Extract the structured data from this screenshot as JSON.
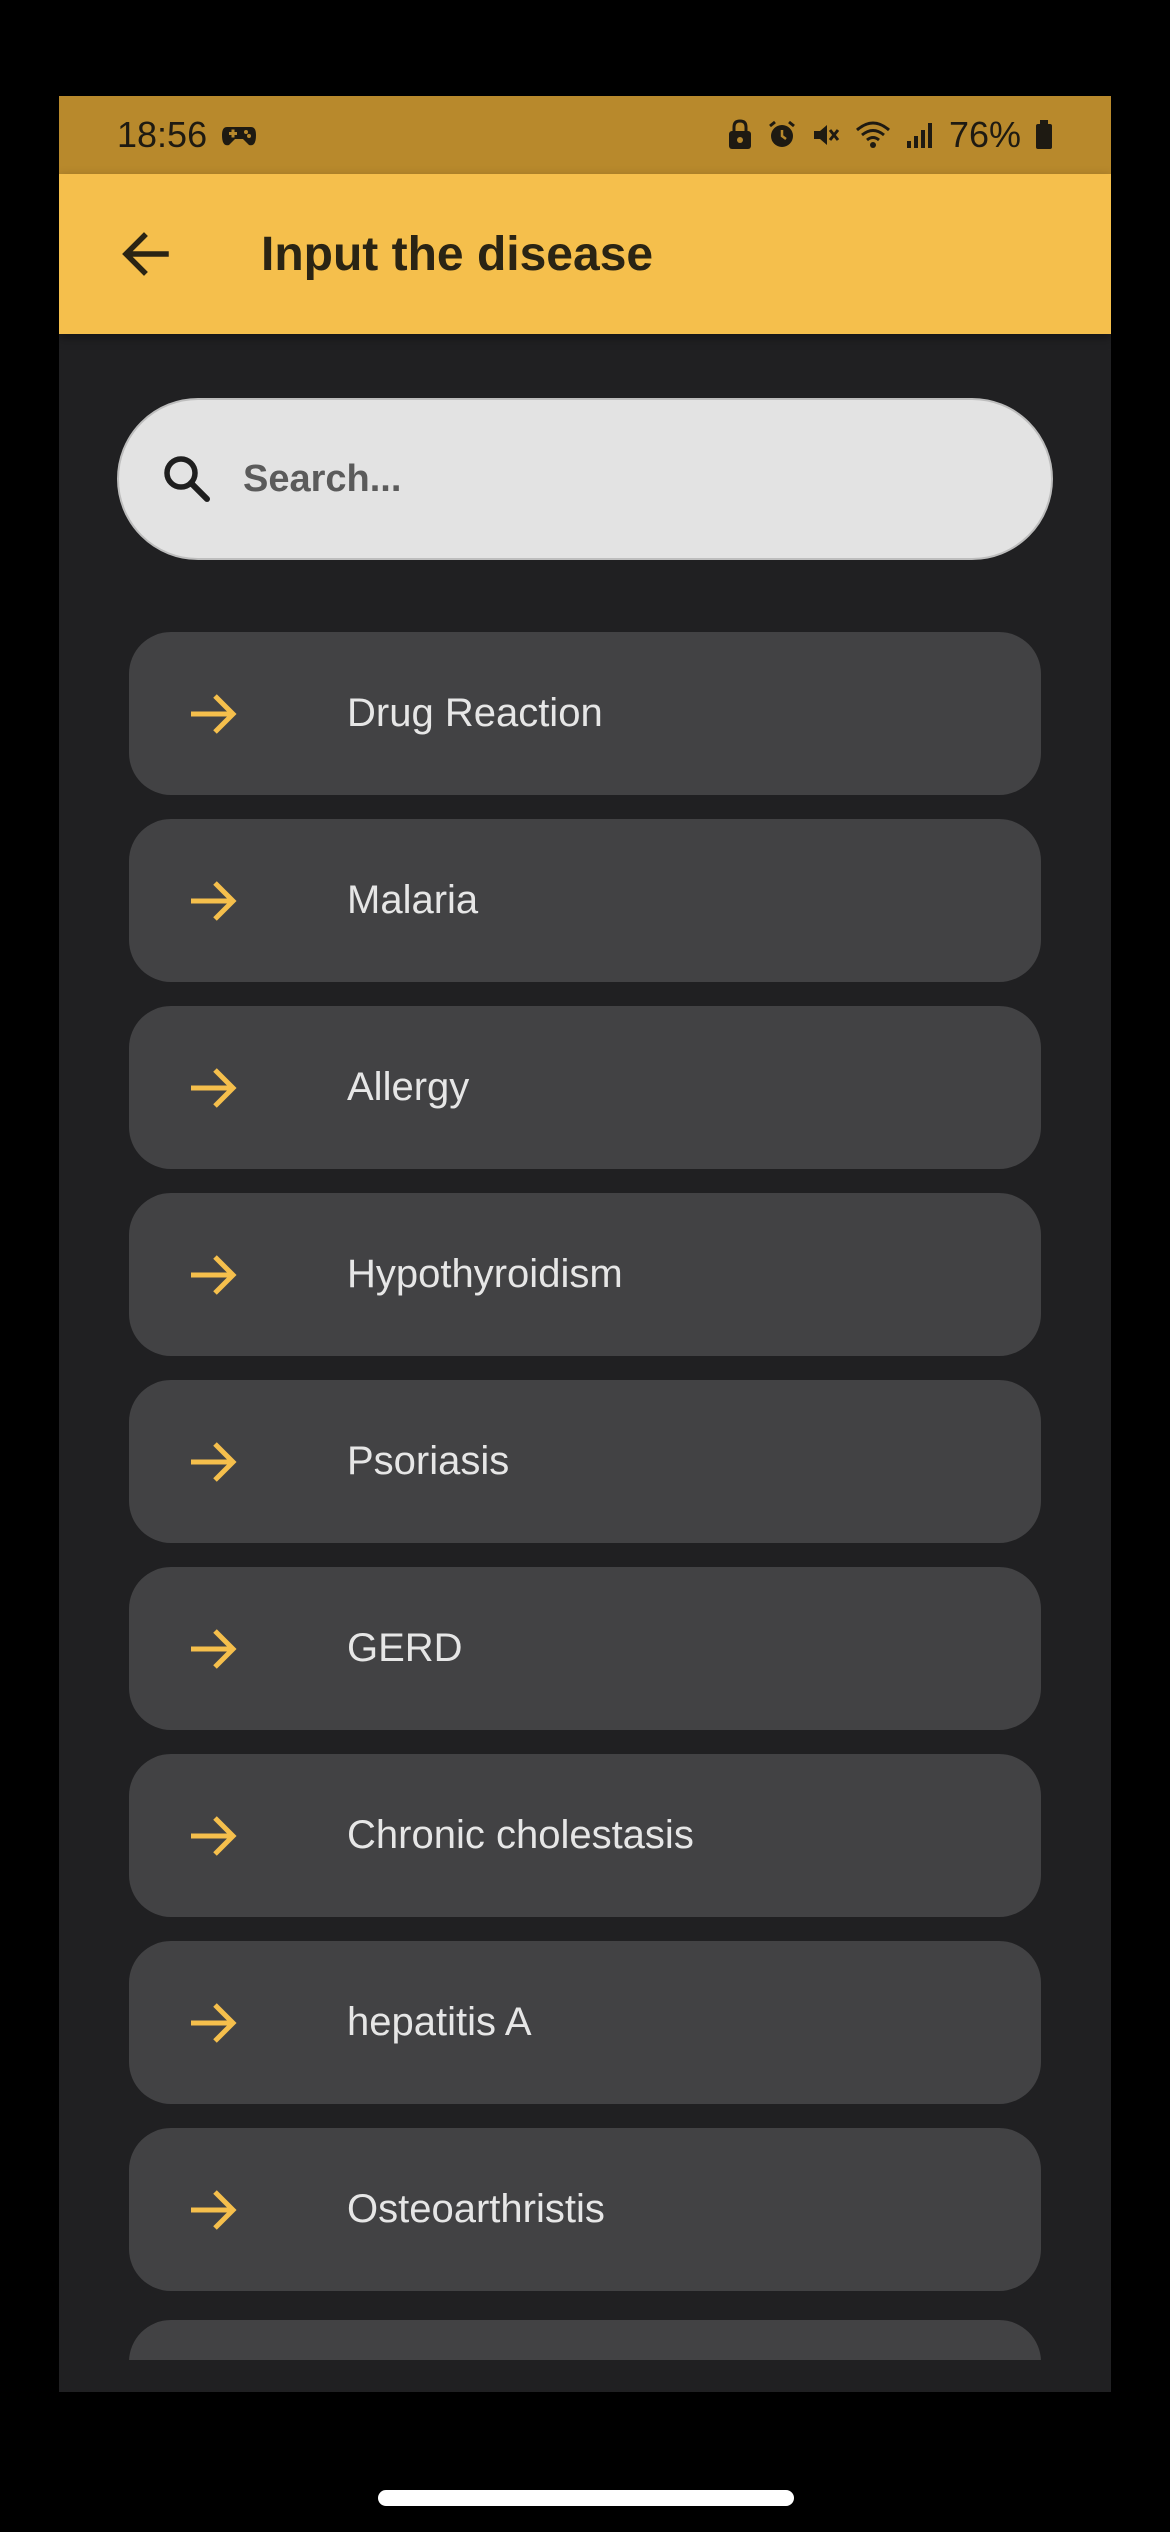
{
  "status_bar": {
    "time": "18:56",
    "battery": "76%",
    "icons": [
      "gamepad-icon",
      "lock-icon",
      "alarm-icon",
      "mute-icon",
      "wifi-icon",
      "signal-icon",
      "battery-icon"
    ]
  },
  "app_bar": {
    "title": "Input the disease",
    "back_icon": "arrow-back-icon"
  },
  "search": {
    "placeholder": "Search...",
    "value": ""
  },
  "diseases": [
    "Drug Reaction",
    "Malaria",
    "Allergy",
    "Hypothyroidism",
    "Psoriasis",
    "GERD",
    "Chronic cholestasis",
    "hepatitis A",
    "Osteoarthristis"
  ],
  "colors": {
    "status_bar": "#b8892c",
    "app_bar": "#f5bf4c",
    "background": "#202022",
    "card": "#424244",
    "arrow": "#f5bf4c",
    "text": "#e6e6e6"
  }
}
